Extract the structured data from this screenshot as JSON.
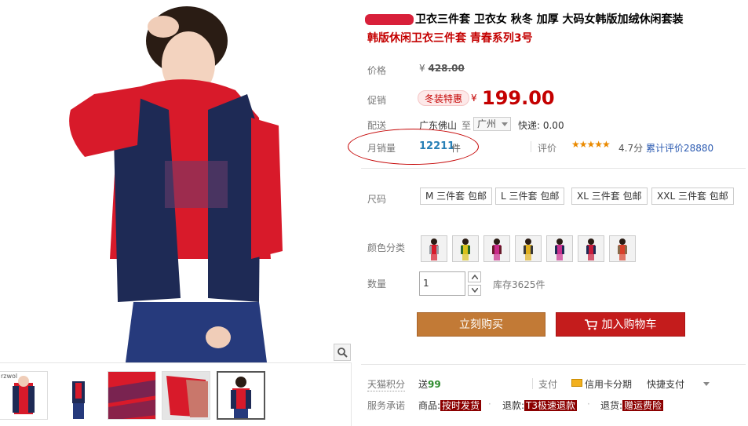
{
  "gallery": {
    "thumbnail_count": 5,
    "active_thumbnail": 4,
    "thumb_watermark": "rzwol"
  },
  "product": {
    "title": "卫衣三件套 卫衣女 秋冬 加厚 大码女韩版加绒休闲套装",
    "subtitle": "韩版休闲卫衣三件套 青春系列3号"
  },
  "price": {
    "label": "价格",
    "currency": "¥",
    "original": "428.00"
  },
  "promo": {
    "label": "促销",
    "badge": "冬装特惠",
    "currency": "¥",
    "price": "199.00"
  },
  "shipping": {
    "label": "配送",
    "from": "广东佛山",
    "to_word": "至",
    "city": "广州",
    "express": "快递: 0.00"
  },
  "sales": {
    "label": "月销量",
    "count": "12211",
    "unit": "件"
  },
  "review": {
    "label": "评价",
    "stars": "★★★★★",
    "rating": 4.7,
    "score": "4.7分",
    "total": "累计评价28880"
  },
  "size": {
    "label": "尺码",
    "options": [
      "M 三件套 包邮",
      "L 三件套 包邮",
      "XL 三件套 包邮",
      "XXL 三件套 包邮"
    ]
  },
  "color": {
    "label": "颜色分类",
    "count": 7
  },
  "quantity": {
    "label": "数量",
    "value": "1",
    "stock": "库存3625件"
  },
  "actions": {
    "buy_now": "立刻购买",
    "add_to_cart": "加入购物车"
  },
  "points": {
    "label": "天猫积分",
    "text": "送",
    "value": "99"
  },
  "payment": {
    "label": "支付",
    "card": "信用卡分期",
    "quick": "快捷支付"
  },
  "service": {
    "label": "服务承诺",
    "items": [
      {
        "prefix": "商品:",
        "tag": "按时发货"
      },
      {
        "prefix": "退款:",
        "tag": "T3极速退款"
      },
      {
        "prefix": "退货:",
        "tag": "赠运费险"
      }
    ]
  },
  "colors": {
    "accent_red": "#c40000",
    "buy_button": "#c27a36",
    "cart_button": "#c41c1c",
    "sales_blue": "#277fb6"
  }
}
